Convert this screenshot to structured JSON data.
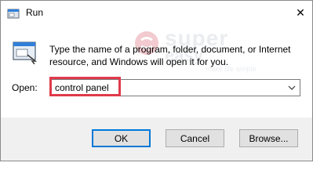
{
  "window": {
    "title": "Run",
    "close_symbol": "✕"
  },
  "description": "Type the name of a program, folder, document, or Internet resource, and Windows will open it for you.",
  "watermark": {
    "line1": "super",
    "line2": "easy",
    "tagline": "make life simple"
  },
  "open_field": {
    "label": "Open:",
    "value": "control panel"
  },
  "buttons": {
    "ok": "OK",
    "cancel": "Cancel",
    "browse": "Browse..."
  },
  "colors": {
    "highlight": "#e03a4b",
    "footer_bg": "#f0f0f0",
    "ok_border": "#0078d7"
  }
}
